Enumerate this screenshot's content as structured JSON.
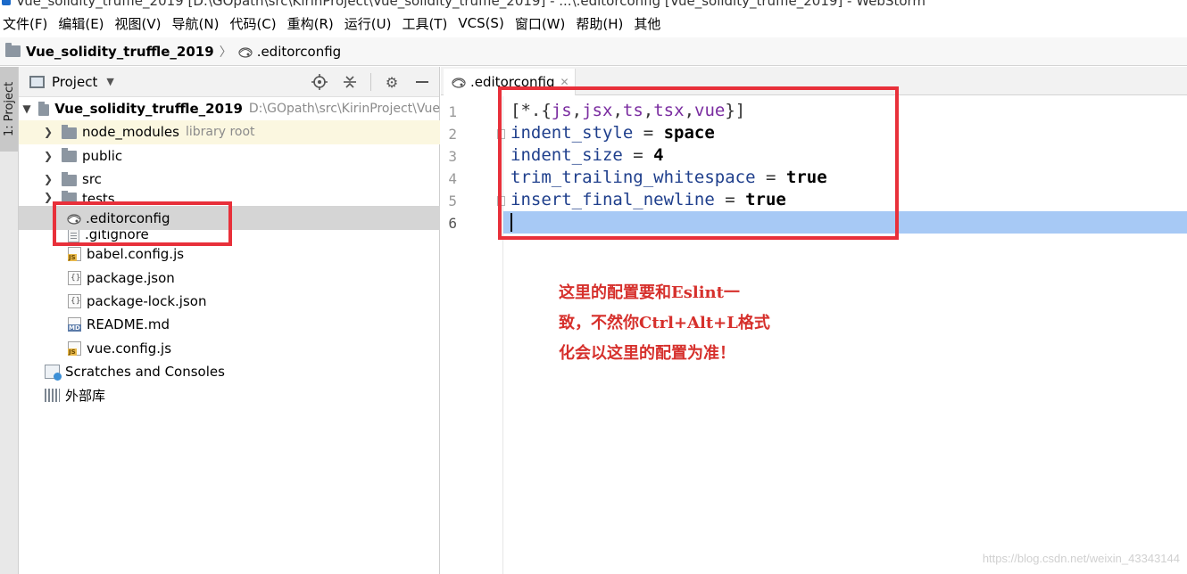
{
  "window": {
    "title": "Vue_solidity_truffle_2019 [D:\\GOpath\\src\\KirinProject\\Vue_solidity_truffle_2019] - ...\\.editorconfig [Vue_solidity_truffle_2019] - WebStorm"
  },
  "menu": [
    "文件(F)",
    "编辑(E)",
    "视图(V)",
    "导航(N)",
    "代码(C)",
    "重构(R)",
    "运行(U)",
    "工具(T)",
    "VCS(S)",
    "窗口(W)",
    "帮助(H)",
    "其他"
  ],
  "breadcrumb": {
    "project": "Vue_solidity_truffle_2019",
    "file": ".editorconfig"
  },
  "toolstrip": {
    "project_tab": "1: Project"
  },
  "project_panel": {
    "title": "Project",
    "root": {
      "name": "Vue_solidity_truffle_2019",
      "path": "D:\\GOpath\\src\\KirinProject\\Vue"
    },
    "items": [
      {
        "name": "node_modules",
        "note": "library root"
      },
      {
        "name": "public"
      },
      {
        "name": "src"
      },
      {
        "name": "tests"
      },
      {
        "name": ".editorconfig"
      },
      {
        "name": ".gitignore"
      },
      {
        "name": "babel.config.js"
      },
      {
        "name": "package.json"
      },
      {
        "name": "package-lock.json"
      },
      {
        "name": "README.md"
      },
      {
        "name": "vue.config.js"
      }
    ],
    "scratches": "Scratches and Consoles",
    "external_libs": "外部库"
  },
  "editor": {
    "tab_label": ".editorconfig",
    "line_numbers": [
      "1",
      "2",
      "3",
      "4",
      "5",
      "6"
    ],
    "code": {
      "line1": {
        "open": "[*.{",
        "exts": [
          "js",
          "jsx",
          "ts",
          "tsx",
          "vue"
        ],
        "close": "}]"
      },
      "line2": {
        "key": "indent_style",
        "eq": " = ",
        "val": "space"
      },
      "line3": {
        "key": "indent_size",
        "eq": " = ",
        "val": "4"
      },
      "line4": {
        "key": "trim_trailing_whitespace",
        "eq": " = ",
        "val": "true"
      },
      "line5": {
        "key": "insert_final_newline",
        "eq": " = ",
        "val": "true"
      }
    }
  },
  "annotation": {
    "line1": "这里的配置要和Eslint一",
    "line2": "致，不然你Ctrl+Alt+L格式",
    "line3": "化会以这里的配置为准！"
  },
  "watermark": "https://blog.csdn.net/weixin_43343144",
  "colors": {
    "annotation_red": "#e8303a",
    "current_line": "#a7c9f5"
  }
}
